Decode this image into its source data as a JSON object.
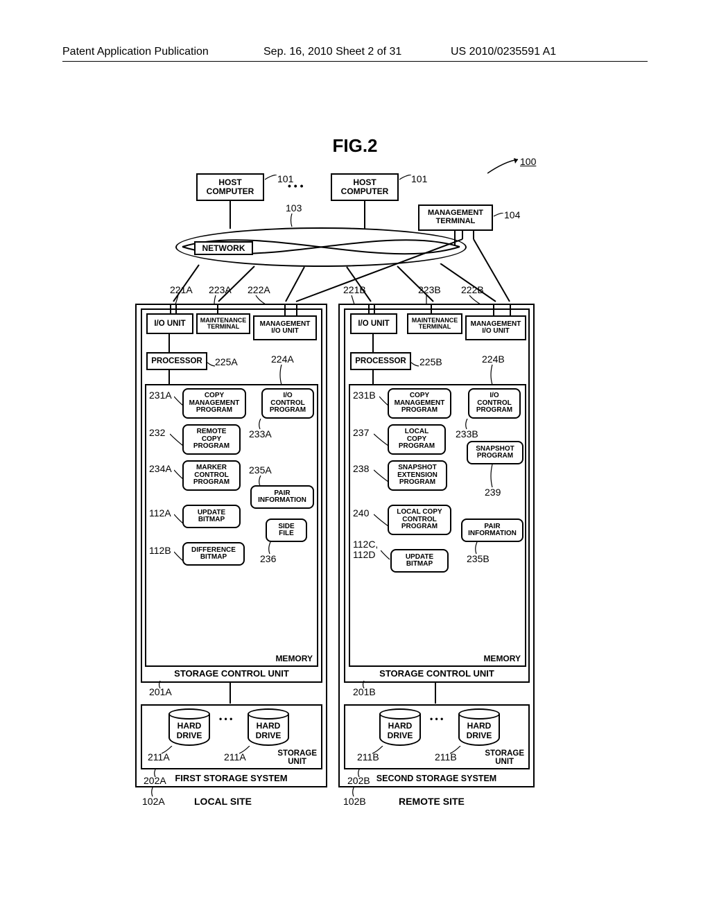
{
  "header": {
    "left": "Patent Application Publication",
    "mid": "Sep. 16, 2010  Sheet 2 of 31",
    "right": "US 2010/0235591 A1"
  },
  "figure_title": "FIG.2",
  "refs": {
    "system": "100",
    "host1": "101",
    "host2": "101",
    "network": "103",
    "mgmt_term": "104",
    "io_a": "221A",
    "maint_a": "223A",
    "mgmtio_a": "222A",
    "io_b": "221B",
    "maint_b": "223B",
    "mgmtio_b": "222B",
    "mem_a": "224A",
    "proc_a": "225A",
    "mem_b": "224B",
    "proc_b": "225B",
    "copy_a": "231A",
    "remote": "232",
    "ioctl_a": "233A",
    "marker": "234A",
    "pair_a": "235A",
    "side": "236",
    "upd_a": "112A",
    "diff": "112B",
    "copy_b": "231B",
    "local": "237",
    "ioctl_b": "233B",
    "snapext": "238",
    "snap": "239",
    "localctl": "240",
    "upd_b": "112C,\n112D",
    "pair_b": "235B",
    "scu_a": "201A",
    "scu_b": "201B",
    "hd_a": "211A",
    "hd_b": "211B",
    "su_a": "202A",
    "su_b": "202B",
    "sys_a": "102A",
    "sys_b": "102B"
  },
  "labels": {
    "host": "HOST\nCOMPUTER",
    "network": "NETWORK",
    "mgmt_term": "MANAGEMENT\nTERMINAL",
    "io_unit": "I/O UNIT",
    "maint": "MAINTENANCE\nTERMINAL",
    "mgmtio": "MANAGEMENT\nI/O UNIT",
    "processor": "PROCESSOR",
    "memory": "MEMORY",
    "copy_mgmt": "COPY\nMANAGEMENT\nPROGRAM",
    "io_ctrl": "I/O\nCONTROL\nPROGRAM",
    "remote_copy": "REMOTE\nCOPY\nPROGRAM",
    "marker": "MARKER\nCONTROL\nPROGRAM",
    "pair": "PAIR\nINFORMATION",
    "update_bmp": "UPDATE\nBITMAP",
    "side_file": "SIDE\nFILE",
    "diff_bmp": "DIFFERENCE\nBITMAP",
    "local_copy": "LOCAL\nCOPY\nPROGRAM",
    "snapshot": "SNAPSHOT\nPROGRAM",
    "snap_ext": "SNAPSHOT\nEXTENSION\nPROGRAM",
    "local_copy_ctl": "LOCAL COPY\nCONTROL\nPROGRAM",
    "scu": "STORAGE CONTROL UNIT",
    "hard_drive": "HARD\nDRIVE",
    "storage_unit": "STORAGE\nUNIT",
    "first_sys": "FIRST STORAGE SYSTEM",
    "second_sys": "SECOND STORAGE SYSTEM",
    "local_site": "LOCAL SITE",
    "remote_site": "REMOTE SITE",
    "dots": "• • •"
  }
}
